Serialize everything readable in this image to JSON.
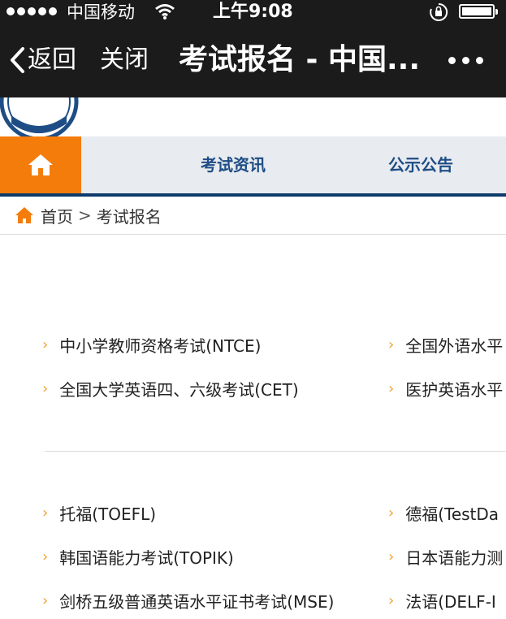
{
  "status_bar": {
    "carrier": "中国移动",
    "time": "上午9:08",
    "icons": [
      "signal-dots-icon",
      "wifi-icon",
      "rotation-lock-icon",
      "battery-icon"
    ]
  },
  "nav_bar": {
    "back_label": "返回",
    "close_label": "关闭",
    "title": "考试报名 - 中国...",
    "icons": [
      "chevron-left-icon",
      "more-dots-icon"
    ]
  },
  "menu": {
    "home_icon": "home-icon",
    "items": [
      "考试资讯",
      "公示公告"
    ],
    "colors": {
      "home_bg": "#f47c0a",
      "bar_bg": "#e8ebef",
      "item_text": "#1e4d86",
      "underline": "#0d3a6b"
    }
  },
  "breadcrumb": {
    "home": "首页",
    "separator": ">",
    "current": "考试报名"
  },
  "exam_groups": [
    {
      "left": [
        "中小学教师资格考试(NTCE)",
        "全国大学英语四、六级考试(CET)"
      ],
      "right": [
        "全国外语水平",
        "医护英语水平"
      ]
    },
    {
      "left": [
        "托福(TOEFL)",
        "韩国语能力考试(TOPIK)",
        "剑桥五级普通英语水平证书考试(MSE)"
      ],
      "right": [
        "德福(TestDa",
        "日本语能力测",
        "法语(DELF-I"
      ]
    }
  ]
}
